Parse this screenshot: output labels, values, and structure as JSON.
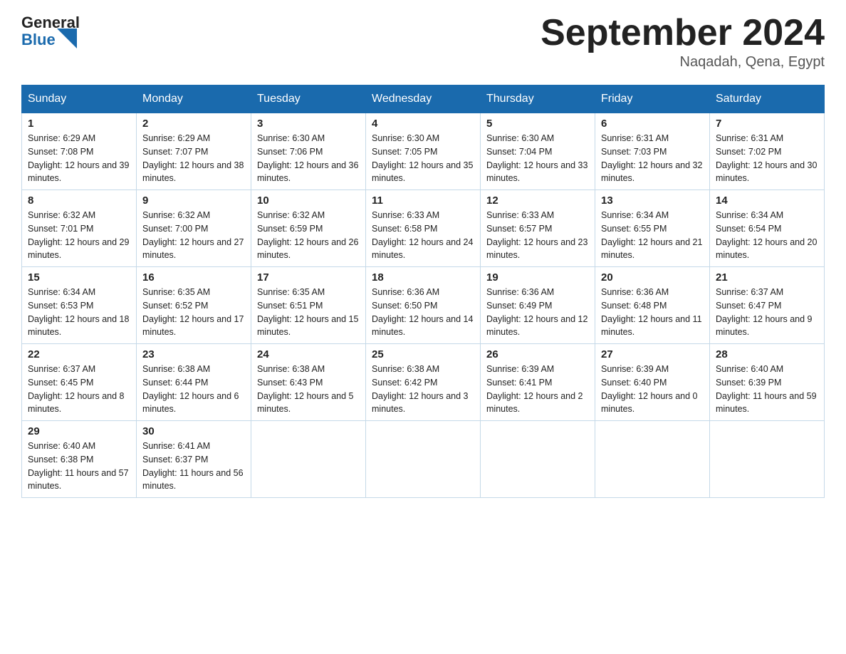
{
  "logo": {
    "general": "General",
    "blue": "Blue"
  },
  "title": "September 2024",
  "location": "Naqadah, Qena, Egypt",
  "days_of_week": [
    "Sunday",
    "Monday",
    "Tuesday",
    "Wednesday",
    "Thursday",
    "Friday",
    "Saturday"
  ],
  "weeks": [
    [
      {
        "day": "1",
        "sunrise": "6:29 AM",
        "sunset": "7:08 PM",
        "daylight": "12 hours and 39 minutes."
      },
      {
        "day": "2",
        "sunrise": "6:29 AM",
        "sunset": "7:07 PM",
        "daylight": "12 hours and 38 minutes."
      },
      {
        "day": "3",
        "sunrise": "6:30 AM",
        "sunset": "7:06 PM",
        "daylight": "12 hours and 36 minutes."
      },
      {
        "day": "4",
        "sunrise": "6:30 AM",
        "sunset": "7:05 PM",
        "daylight": "12 hours and 35 minutes."
      },
      {
        "day": "5",
        "sunrise": "6:30 AM",
        "sunset": "7:04 PM",
        "daylight": "12 hours and 33 minutes."
      },
      {
        "day": "6",
        "sunrise": "6:31 AM",
        "sunset": "7:03 PM",
        "daylight": "12 hours and 32 minutes."
      },
      {
        "day": "7",
        "sunrise": "6:31 AM",
        "sunset": "7:02 PM",
        "daylight": "12 hours and 30 minutes."
      }
    ],
    [
      {
        "day": "8",
        "sunrise": "6:32 AM",
        "sunset": "7:01 PM",
        "daylight": "12 hours and 29 minutes."
      },
      {
        "day": "9",
        "sunrise": "6:32 AM",
        "sunset": "7:00 PM",
        "daylight": "12 hours and 27 minutes."
      },
      {
        "day": "10",
        "sunrise": "6:32 AM",
        "sunset": "6:59 PM",
        "daylight": "12 hours and 26 minutes."
      },
      {
        "day": "11",
        "sunrise": "6:33 AM",
        "sunset": "6:58 PM",
        "daylight": "12 hours and 24 minutes."
      },
      {
        "day": "12",
        "sunrise": "6:33 AM",
        "sunset": "6:57 PM",
        "daylight": "12 hours and 23 minutes."
      },
      {
        "day": "13",
        "sunrise": "6:34 AM",
        "sunset": "6:55 PM",
        "daylight": "12 hours and 21 minutes."
      },
      {
        "day": "14",
        "sunrise": "6:34 AM",
        "sunset": "6:54 PM",
        "daylight": "12 hours and 20 minutes."
      }
    ],
    [
      {
        "day": "15",
        "sunrise": "6:34 AM",
        "sunset": "6:53 PM",
        "daylight": "12 hours and 18 minutes."
      },
      {
        "day": "16",
        "sunrise": "6:35 AM",
        "sunset": "6:52 PM",
        "daylight": "12 hours and 17 minutes."
      },
      {
        "day": "17",
        "sunrise": "6:35 AM",
        "sunset": "6:51 PM",
        "daylight": "12 hours and 15 minutes."
      },
      {
        "day": "18",
        "sunrise": "6:36 AM",
        "sunset": "6:50 PM",
        "daylight": "12 hours and 14 minutes."
      },
      {
        "day": "19",
        "sunrise": "6:36 AM",
        "sunset": "6:49 PM",
        "daylight": "12 hours and 12 minutes."
      },
      {
        "day": "20",
        "sunrise": "6:36 AM",
        "sunset": "6:48 PM",
        "daylight": "12 hours and 11 minutes."
      },
      {
        "day": "21",
        "sunrise": "6:37 AM",
        "sunset": "6:47 PM",
        "daylight": "12 hours and 9 minutes."
      }
    ],
    [
      {
        "day": "22",
        "sunrise": "6:37 AM",
        "sunset": "6:45 PM",
        "daylight": "12 hours and 8 minutes."
      },
      {
        "day": "23",
        "sunrise": "6:38 AM",
        "sunset": "6:44 PM",
        "daylight": "12 hours and 6 minutes."
      },
      {
        "day": "24",
        "sunrise": "6:38 AM",
        "sunset": "6:43 PM",
        "daylight": "12 hours and 5 minutes."
      },
      {
        "day": "25",
        "sunrise": "6:38 AM",
        "sunset": "6:42 PM",
        "daylight": "12 hours and 3 minutes."
      },
      {
        "day": "26",
        "sunrise": "6:39 AM",
        "sunset": "6:41 PM",
        "daylight": "12 hours and 2 minutes."
      },
      {
        "day": "27",
        "sunrise": "6:39 AM",
        "sunset": "6:40 PM",
        "daylight": "12 hours and 0 minutes."
      },
      {
        "day": "28",
        "sunrise": "6:40 AM",
        "sunset": "6:39 PM",
        "daylight": "11 hours and 59 minutes."
      }
    ],
    [
      {
        "day": "29",
        "sunrise": "6:40 AM",
        "sunset": "6:38 PM",
        "daylight": "11 hours and 57 minutes."
      },
      {
        "day": "30",
        "sunrise": "6:41 AM",
        "sunset": "6:37 PM",
        "daylight": "11 hours and 56 minutes."
      },
      null,
      null,
      null,
      null,
      null
    ]
  ]
}
